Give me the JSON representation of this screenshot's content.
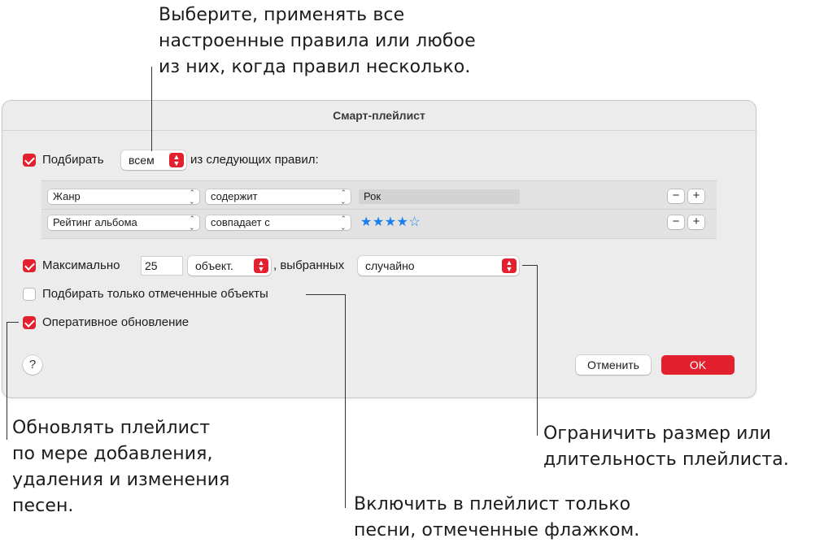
{
  "callouts": {
    "top": "Выберите, применять все\nнастроенные правила или любое\nиз них, когда правил несколько.",
    "left": "Обновлять плейлист\nпо мере добавления,\nудаления и изменения\nпесен.",
    "middle": "Включить в плейлист только\nпесни, отмеченные флажком.",
    "right": "Ограничить размер или\nдлительность плейлиста."
  },
  "dialog": {
    "title": "Смарт-плейлист",
    "match": {
      "checked": true,
      "label": "Подбирать",
      "selector": "всем",
      "suffix": "из следующих правил:"
    },
    "rules": [
      {
        "field": "Жанр",
        "operator": "содержит",
        "value": "Рок"
      },
      {
        "field": "Рейтинг альбома",
        "operator": "совпадает с",
        "value": "★★★★☆",
        "rating": 4
      }
    ],
    "rule_buttons": {
      "remove": "−",
      "add": "+"
    },
    "limit": {
      "checked": true,
      "label": "Максимально",
      "count": "25",
      "unit": "объект.",
      "selected_by": ", выбранных",
      "method": "случайно"
    },
    "checked_only": {
      "checked": false,
      "label": "Подбирать только отмеченные объекты"
    },
    "live_update": {
      "checked": true,
      "label": "Оперативное обновление"
    },
    "help": "?",
    "cancel": "Отменить",
    "ok": "OK"
  },
  "colors": {
    "accent": "#e3202e",
    "stars": "#1a7ef0",
    "dialog_bg": "#ececec"
  }
}
